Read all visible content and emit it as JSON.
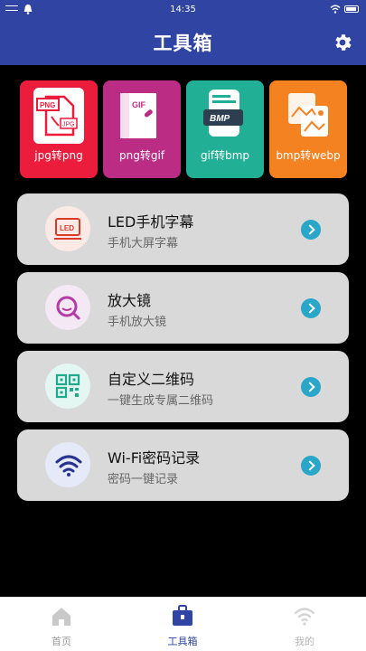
{
  "status_bar": {
    "time": "14:35"
  },
  "header": {
    "title": "工具箱"
  },
  "tools": [
    {
      "label": "jpg转png",
      "color": "#ec1c3c",
      "icon": "jpg-to-png-icon"
    },
    {
      "label": "png转gif",
      "color": "#bb2c85",
      "icon": "png-to-gif-icon"
    },
    {
      "label": "gif转bmp",
      "color": "#21b095",
      "icon": "gif-to-bmp-icon"
    },
    {
      "label": "bmp转webp",
      "color": "#f58220",
      "icon": "bmp-to-webp-icon"
    }
  ],
  "features": [
    {
      "title": "LED手机字幕",
      "subtitle": "手机大屏字幕",
      "icon": "led-icon"
    },
    {
      "title": "放大镜",
      "subtitle": "手机放大镜",
      "icon": "magnifier-icon"
    },
    {
      "title": "自定义二维码",
      "subtitle": "一键生成专属二维码",
      "icon": "qr-code-icon"
    },
    {
      "title": "Wi-Fi密码记录",
      "subtitle": "密码一键记录",
      "icon": "wifi-icon"
    }
  ],
  "tabbar": {
    "items": [
      {
        "label": "首页",
        "active": false
      },
      {
        "label": "工具箱",
        "active": true
      },
      {
        "label": "我的",
        "active": false
      }
    ]
  },
  "colors": {
    "header_bg": "#2f44a3",
    "accent": "#2aa6c8",
    "active_tab": "#2f44a3",
    "inactive_tab": "#9a9a9a"
  }
}
